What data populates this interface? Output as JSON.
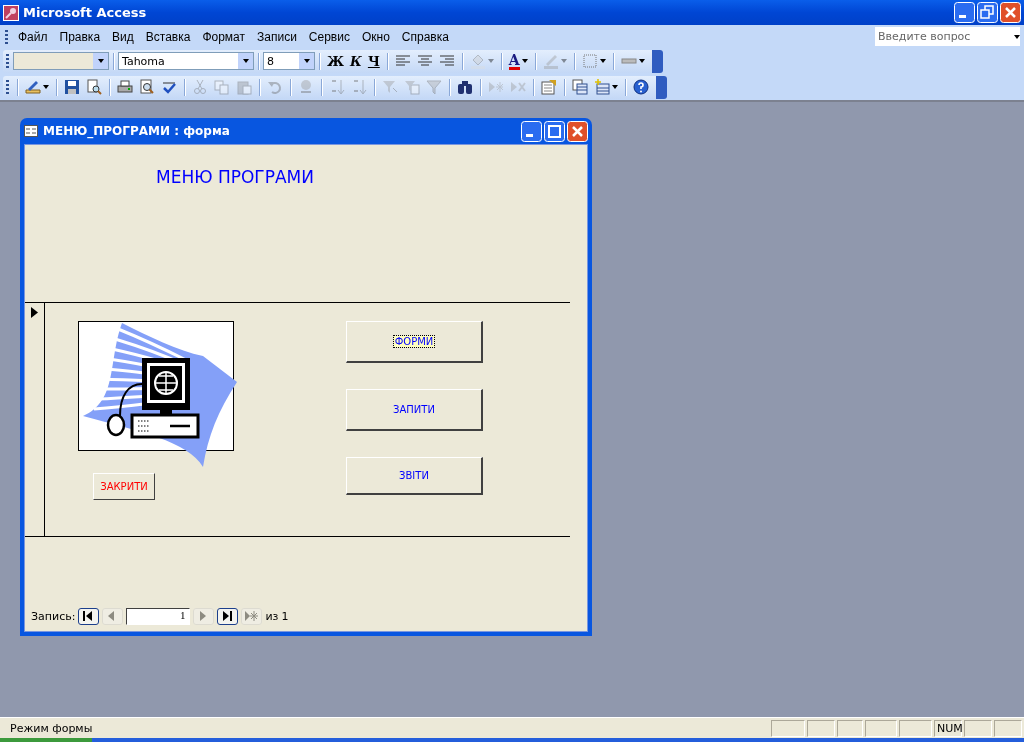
{
  "app_window": {
    "title": "Microsoft Access"
  },
  "menu": [
    {
      "label": "Файл"
    },
    {
      "label": "Правка"
    },
    {
      "label": "Вид"
    },
    {
      "label": "Вставка"
    },
    {
      "label": "Формат"
    },
    {
      "label": "Записи"
    },
    {
      "label": "Сервис"
    },
    {
      "label": "Окно"
    },
    {
      "label": "Справка"
    }
  ],
  "help_box": {
    "placeholder": "Введите вопрос"
  },
  "format_toolbar": {
    "font": "Tahoma",
    "size": "8",
    "groups": [
      [
        {
          "kind": "bold",
          "label": "Ж",
          "disabled": false,
          "dropdown": false
        },
        {
          "kind": "italic",
          "label": "К",
          "disabled": false,
          "dropdown": false
        },
        {
          "kind": "underline",
          "label": "Ч",
          "disabled": false,
          "dropdown": false
        }
      ],
      [
        {
          "kind": "align-left",
          "disabled": false,
          "dropdown": false
        },
        {
          "kind": "align-center",
          "disabled": false,
          "dropdown": false
        },
        {
          "kind": "align-right",
          "disabled": false,
          "dropdown": false
        }
      ],
      [
        {
          "kind": "fill-color",
          "disabled": true,
          "dropdown": true
        }
      ],
      [
        {
          "kind": "font-color",
          "label": "A",
          "disabled": false,
          "dropdown": true
        }
      ],
      [
        {
          "kind": "line-color",
          "disabled": true,
          "dropdown": true
        }
      ],
      [
        {
          "kind": "border",
          "disabled": false,
          "dropdown": true
        }
      ],
      [
        {
          "kind": "line-width",
          "disabled": false,
          "dropdown": true
        }
      ]
    ]
  },
  "database_toolbar": {
    "groups": [
      [
        {
          "kind": "view",
          "disabled": false,
          "dropdown": true
        }
      ],
      [
        {
          "kind": "save",
          "disabled": false,
          "dropdown": false
        },
        {
          "kind": "file-search",
          "disabled": false,
          "dropdown": false
        }
      ],
      [
        {
          "kind": "print",
          "disabled": false,
          "dropdown": false
        },
        {
          "kind": "preview",
          "disabled": false,
          "dropdown": false
        },
        {
          "kind": "spelling",
          "disabled": false,
          "dropdown": false
        }
      ],
      [
        {
          "kind": "cut",
          "disabled": true,
          "dropdown": false
        },
        {
          "kind": "copy",
          "disabled": true,
          "dropdown": false
        },
        {
          "kind": "paste",
          "disabled": true,
          "dropdown": false
        }
      ],
      [
        {
          "kind": "undo",
          "disabled": true,
          "dropdown": false
        }
      ],
      [
        {
          "kind": "hyperlink",
          "disabled": true,
          "dropdown": false
        }
      ],
      [
        {
          "kind": "sort-asc",
          "disabled": true,
          "dropdown": false
        },
        {
          "kind": "sort-desc",
          "disabled": true,
          "dropdown": false
        }
      ],
      [
        {
          "kind": "filter-selection",
          "disabled": true,
          "dropdown": false
        },
        {
          "kind": "filter-form",
          "disabled": true,
          "dropdown": false
        },
        {
          "kind": "filter",
          "disabled": true,
          "dropdown": false
        }
      ],
      [
        {
          "kind": "find",
          "disabled": false,
          "dropdown": false
        }
      ],
      [
        {
          "kind": "new-record",
          "disabled": true,
          "dropdown": false
        },
        {
          "kind": "delete-record",
          "disabled": true,
          "dropdown": false
        }
      ],
      [
        {
          "kind": "properties",
          "disabled": false,
          "dropdown": false
        }
      ],
      [
        {
          "kind": "db-window",
          "disabled": false,
          "dropdown": false
        },
        {
          "kind": "new-object",
          "disabled": false,
          "dropdown": true
        }
      ],
      [
        {
          "kind": "help",
          "disabled": false,
          "dropdown": false
        }
      ]
    ]
  },
  "form_window": {
    "title": "МЕНЮ_ПРОГРАМИ : форма",
    "heading": "МЕНЮ ПРОГРАМИ",
    "buttons": [
      {
        "label": "ФОРМИ",
        "focused": true
      },
      {
        "label": "ЗАПИТИ",
        "focused": false
      },
      {
        "label": "ЗВІТИ",
        "focused": false
      }
    ],
    "close_button": {
      "label": "ЗАКРИТИ"
    },
    "navigation": {
      "label": "Запись:",
      "record": "1",
      "of_label": "из",
      "total": "1",
      "buttons": [
        {
          "kind": "first",
          "disabled": false
        },
        {
          "kind": "prev",
          "disabled": true
        },
        {
          "kind": "record"
        },
        {
          "kind": "next",
          "disabled": true
        },
        {
          "kind": "last",
          "disabled": false
        },
        {
          "kind": "new",
          "disabled": true
        }
      ]
    }
  },
  "status_bar": {
    "text": "Режим формы",
    "indicators": [
      "NUM"
    ]
  }
}
